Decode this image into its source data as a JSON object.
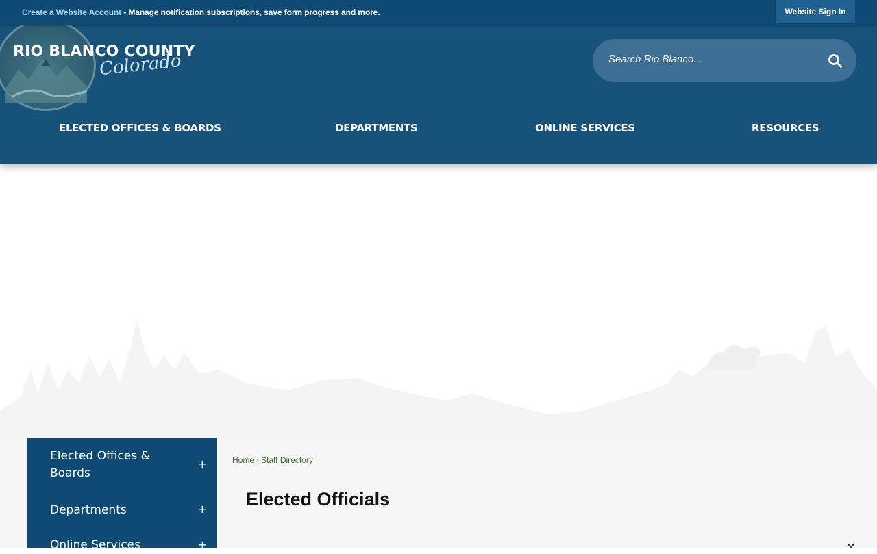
{
  "topbar": {
    "create_account_link": "Create a Website Account",
    "create_account_desc": " - Manage notification subscriptions, save form progress and more.",
    "sign_in": "Website Sign In"
  },
  "header": {
    "logo_title": "RIO BLANCO COUNTY",
    "logo_script": "Colorado",
    "search_placeholder": "Search Rio Blanco...",
    "nav": [
      "ELECTED OFFICES & BOARDS",
      "DEPARTMENTS",
      "ONLINE SERVICES",
      "RESOURCES"
    ]
  },
  "sidebar": {
    "items": [
      {
        "label": "Elected Offices & Boards",
        "toggle": "+"
      },
      {
        "label": "Departments",
        "toggle": "+"
      },
      {
        "label": "Online Services",
        "toggle": "+"
      }
    ]
  },
  "breadcrumb": {
    "home": "Home",
    "separator": "›",
    "current": "Staff Directory"
  },
  "page": {
    "title": "Elected Officials"
  },
  "icons": {
    "search": "search-icon",
    "collapse": "chevron-icon"
  },
  "colors": {
    "topbar_bg": "#0e4a74",
    "header_bg": "#17527a",
    "search_bg": "#3d6e94",
    "sidebar_bg": "#0e4a74",
    "breadcrumb_link": "#3b6b2d"
  }
}
